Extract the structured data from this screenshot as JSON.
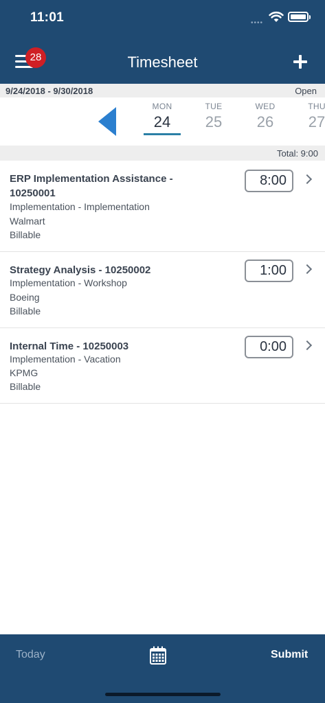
{
  "status_bar": {
    "time": "11:01",
    "signal_dots": "••••"
  },
  "header": {
    "badge_count": "28",
    "title": "Timesheet"
  },
  "period": {
    "range": "9/24/2018 - 9/30/2018",
    "status": "Open"
  },
  "days": [
    {
      "name": "MON",
      "number": "24",
      "active": true
    },
    {
      "name": "TUE",
      "number": "25",
      "active": false
    },
    {
      "name": "WED",
      "number": "26",
      "active": false
    },
    {
      "name": "THU",
      "number": "27",
      "active": false
    }
  ],
  "total": {
    "label": "Total: 9:00"
  },
  "entries": [
    {
      "title": "ERP Implementation Assistance - 10250001",
      "activity": "Implementation - Implementation",
      "client": "Walmart",
      "billing": "Billable",
      "hours": "8:00"
    },
    {
      "title": "Strategy Analysis - 10250002",
      "activity": "Implementation - Workshop",
      "client": "Boeing",
      "billing": "Billable",
      "hours": "1:00"
    },
    {
      "title": "Internal Time - 10250003",
      "activity": "Implementation - Vacation",
      "client": "KPMG",
      "billing": "Billable",
      "hours": "0:00"
    }
  ],
  "tab_bar": {
    "today_label": "Today",
    "submit_label": "Submit"
  },
  "colors": {
    "brand": "#1f4a72",
    "accent": "#2b7fcf",
    "badge": "#cf1f25"
  }
}
